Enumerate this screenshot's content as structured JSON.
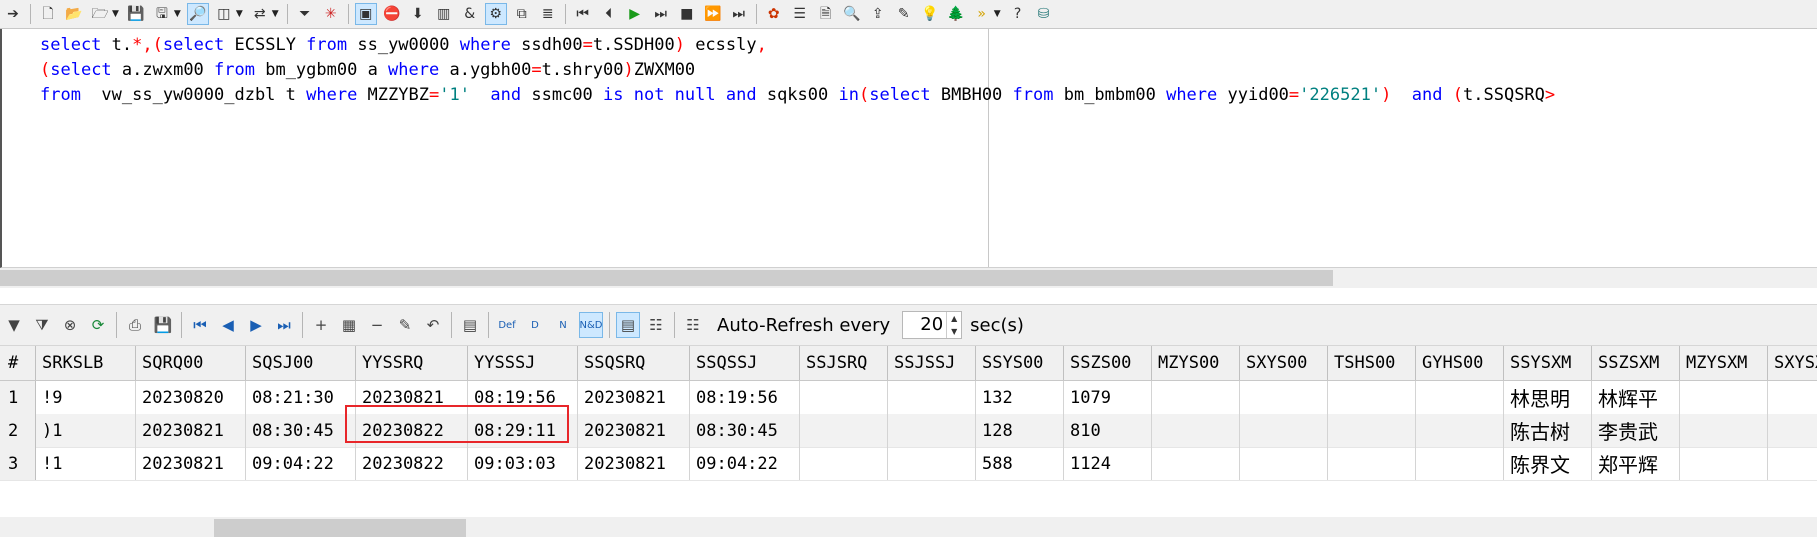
{
  "toolbar": {
    "icons": [
      "arrow-right-icon",
      "new-file-icon",
      "open-file-icon",
      "open-folder-icon",
      "save-icon",
      "save-as-icon",
      "find-text-icon",
      "layout-icon",
      "transfer-icon",
      "filter-icon",
      "clear-filter-icon",
      "explain-plan-icon",
      "stop-query-icon",
      "download-icon",
      "report-icon",
      "link-icon",
      "compile-icon",
      "copy-icon",
      "format-icon",
      "first-record-icon",
      "prior-record-icon",
      "play-icon",
      "next-page-icon",
      "stop-icon",
      "last-record-icon",
      "skip-icon",
      "debug-icon",
      "outline-icon",
      "document-icon",
      "search-doc-icon",
      "export-icon",
      "edit-doc-icon",
      "bulb-icon",
      "tree-icon",
      "forward-icon",
      "help-icon",
      "database-icon"
    ]
  },
  "editor": {
    "lines": [
      [
        {
          "t": "select",
          "c": "kw"
        },
        {
          "t": " t."
        },
        {
          "t": "*,(",
          "c": "pn"
        },
        {
          "t": "select",
          "c": "kw"
        },
        {
          "t": " ECSSLY "
        },
        {
          "t": "from",
          "c": "kw"
        },
        {
          "t": " ss_yw0000 "
        },
        {
          "t": "where",
          "c": "kw"
        },
        {
          "t": " ssdh00"
        },
        {
          "t": "=",
          "c": "pn"
        },
        {
          "t": "t.SSDH00"
        },
        {
          "t": ")",
          "c": "pn"
        },
        {
          "t": " ecssly"
        },
        {
          "t": ",",
          "c": "pn"
        }
      ],
      [
        {
          "t": "(",
          "c": "pn"
        },
        {
          "t": "select",
          "c": "kw"
        },
        {
          "t": " a.zwxm00 "
        },
        {
          "t": "from",
          "c": "kw"
        },
        {
          "t": " bm_ygbm00 a "
        },
        {
          "t": "where",
          "c": "kw"
        },
        {
          "t": " a.ygbh00"
        },
        {
          "t": "=",
          "c": "pn"
        },
        {
          "t": "t.shry00"
        },
        {
          "t": ")",
          "c": "pn"
        },
        {
          "t": "ZWXM00"
        }
      ],
      [
        {
          "t": "from",
          "c": "kw"
        },
        {
          "t": "  vw_ss_yw0000_dzbl t "
        },
        {
          "t": "where",
          "c": "kw"
        },
        {
          "t": " MZZYBZ"
        },
        {
          "t": "=",
          "c": "pn"
        },
        {
          "t": "'1'",
          "c": "st"
        },
        {
          "t": "  "
        },
        {
          "t": "and",
          "c": "kw"
        },
        {
          "t": " ssmc00 "
        },
        {
          "t": "is not null",
          "c": "kw"
        },
        {
          "t": " "
        },
        {
          "t": "and",
          "c": "kw"
        },
        {
          "t": " sqks00 "
        },
        {
          "t": "in",
          "c": "kw"
        },
        {
          "t": "(",
          "c": "pn"
        },
        {
          "t": "select",
          "c": "kw"
        },
        {
          "t": " BMBH00 "
        },
        {
          "t": "from",
          "c": "kw"
        },
        {
          "t": " bm_bmbm00 "
        },
        {
          "t": "where",
          "c": "kw"
        },
        {
          "t": " yyid00"
        },
        {
          "t": "=",
          "c": "pn"
        },
        {
          "t": "'226521'",
          "c": "st"
        },
        {
          "t": ")",
          "c": "pn"
        },
        {
          "t": "  "
        },
        {
          "t": "and",
          "c": "kw"
        },
        {
          "t": " "
        },
        {
          "t": "(",
          "c": "pn"
        },
        {
          "t": "t.SSQSRQ"
        },
        {
          "t": ">",
          "c": "pn"
        }
      ]
    ]
  },
  "grid_toolbar": {
    "icons": [
      "filter-icon",
      "funnel-icon",
      "cancel-icon",
      "refresh-icon",
      "print-icon",
      "save-icon",
      "first-record-icon",
      "prior-record-icon",
      "next-record-icon",
      "last-record-icon",
      "insert-record-icon",
      "grid-icon",
      "delete-record-icon",
      "post-edit-icon",
      "cancel-edit-icon",
      "calculator-icon",
      "set-default-icon",
      "set-null-icon",
      "set-blank-icon",
      "set-null-default-icon",
      "grid-view-icon",
      "record-view-icon",
      "single-record-icon"
    ],
    "glyphs": [
      "▼",
      "⧩",
      "⊗",
      "⟳",
      "⎙",
      "💾",
      "⏮",
      "◀",
      "▶",
      "⏭",
      "+",
      "▦",
      "−",
      "✎",
      "↶",
      "▤",
      "Def",
      "D",
      "N",
      "N&D",
      "▤",
      "☷",
      "☷"
    ],
    "auto_refresh_label": "Auto-Refresh every",
    "auto_refresh_value": "20",
    "auto_refresh_unit": "sec(s)"
  },
  "grid": {
    "columns": [
      "#",
      "SRKSLB",
      "SQRQ00",
      "SQSJ00",
      "YYSSRQ",
      "YYSSSJ",
      "SSQSRQ",
      "SSQSSJ",
      "SSJSRQ",
      "SSJSSJ",
      "SSYS00",
      "SSZS00",
      "MZYS00",
      "SXYS00",
      "TSHS00",
      "GYHS00",
      "SSYSXM",
      "SSZSXM",
      "MZYSXM",
      "SXYSX"
    ],
    "rows": [
      [
        "1",
        "!9",
        "20230820",
        "08:21:30",
        "20230821",
        "08:19:56",
        "20230821",
        "08:19:56",
        "",
        "",
        "132",
        "1079",
        "",
        "",
        "",
        "",
        "林思明",
        "林辉平",
        "",
        ""
      ],
      [
        "2",
        ")1",
        "20230821",
        "08:30:45",
        "20230822",
        "08:29:11",
        "20230821",
        "08:30:45",
        "",
        "",
        "128",
        "810",
        "",
        "",
        "",
        "",
        "陈古树",
        "李贵武",
        "",
        ""
      ],
      [
        "3",
        "!1",
        "20230821",
        "09:04:22",
        "20230822",
        "09:03:03",
        "20230821",
        "09:04:22",
        "",
        "",
        "588",
        "1124",
        "",
        "",
        "",
        "",
        "陈界文",
        "郑平辉",
        "",
        ""
      ]
    ]
  },
  "colors": {
    "keyword": "#0000ff",
    "punct": "#ff0000",
    "string": "#008080",
    "highlight": "#e8262a"
  }
}
